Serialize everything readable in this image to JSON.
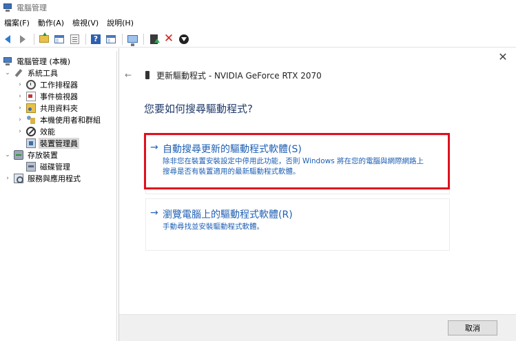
{
  "window": {
    "title": "電腦管理",
    "icon": "computer-management-icon"
  },
  "menu": [
    {
      "label": "檔案(F)"
    },
    {
      "label": "動作(A)"
    },
    {
      "label": "檢視(V)"
    },
    {
      "label": "說明(H)"
    }
  ],
  "toolbar": {
    "icons": [
      "back-arrow-icon",
      "forward-arrow-icon",
      "up-folder-icon",
      "show-hide-tree-icon",
      "properties-icon",
      "help-icon",
      "show-pane-icon",
      "scan-hardware-icon",
      "update-driver-icon",
      "uninstall-icon",
      "download-icon"
    ],
    "uninstall_color": "#d81e1e",
    "back_color": "#2b7cd3"
  },
  "tree": {
    "root": "電腦管理 (本機)",
    "system_tools": "系統工具",
    "task_scheduler": "工作排程器",
    "event_viewer": "事件檢視器",
    "shared_folders": "共用資料夾",
    "local_users": "本機使用者和群組",
    "performance": "效能",
    "device_manager": "裝置管理員",
    "storage": "存放裝置",
    "disk_management": "磁碟管理",
    "services": "服務與應用程式"
  },
  "dialog": {
    "header": "更新驅動程式 - NVIDIA GeForce RTX 2070",
    "question": "您要如何搜尋驅動程式?",
    "back_symbol": "←",
    "close_symbol": "✕",
    "option1": {
      "arrow": "→",
      "title": "自動搜尋更新的驅動程式軟體(S)",
      "desc_line1": "除非您在裝置安裝設定中停用此功能，否則 Windows 將在您的電腦與網際網路上",
      "desc_line2": "搜尋是否有裝置適用的最新驅動程式軟體。"
    },
    "option2": {
      "arrow": "→",
      "title": "瀏覽電腦上的驅動程式軟體(R)",
      "desc": "手動尋找並安裝驅動程式軟體。"
    },
    "cancel_label": "取消",
    "link_color": "#1e5fb4",
    "highlight_color": "#e0101c"
  }
}
